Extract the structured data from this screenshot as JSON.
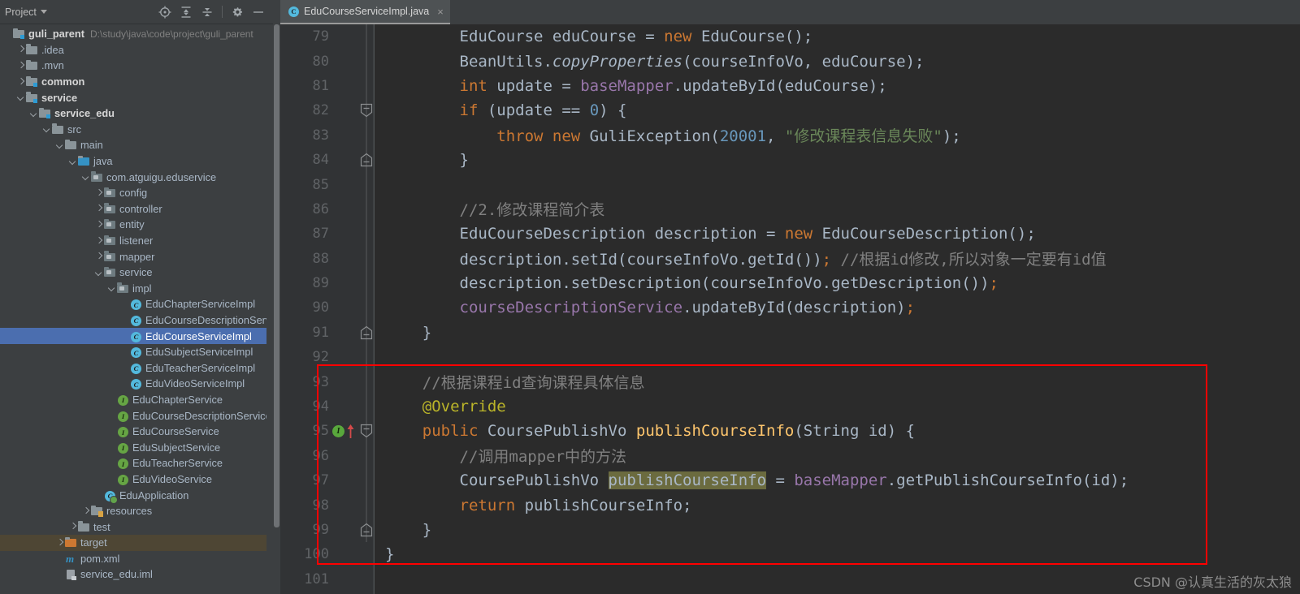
{
  "project_panel": {
    "tab_label": "Project",
    "toolbar_icons": [
      {
        "name": "locate-target-icon",
        "glyph": "target"
      },
      {
        "name": "expand-all-icon",
        "glyph": "expand"
      },
      {
        "name": "collapse-all-icon",
        "glyph": "collapse"
      },
      {
        "name": "settings-gear-icon",
        "glyph": "gear"
      },
      {
        "name": "hide-panel-icon",
        "glyph": "minus"
      }
    ],
    "tree": [
      {
        "label": "guli_parent",
        "path": "D:\\study\\java\\code\\project\\guli_parent",
        "depth": 0,
        "arrow": "none",
        "icon": "module-folder",
        "bold": true,
        "state": "normal"
      },
      {
        "label": ".idea",
        "path": "",
        "depth": 1,
        "arrow": "right",
        "icon": "folder",
        "bold": false,
        "state": "normal"
      },
      {
        "label": ".mvn",
        "path": "",
        "depth": 1,
        "arrow": "right",
        "icon": "folder",
        "bold": false,
        "state": "normal"
      },
      {
        "label": "common",
        "path": "",
        "depth": 1,
        "arrow": "right",
        "icon": "module-folder",
        "bold": true,
        "state": "normal"
      },
      {
        "label": "service",
        "path": "",
        "depth": 1,
        "arrow": "down",
        "icon": "module-folder",
        "bold": true,
        "state": "normal"
      },
      {
        "label": "service_edu",
        "path": "",
        "depth": 2,
        "arrow": "down",
        "icon": "module-folder",
        "bold": true,
        "state": "normal"
      },
      {
        "label": "src",
        "path": "",
        "depth": 3,
        "arrow": "down",
        "icon": "folder",
        "bold": false,
        "state": "normal"
      },
      {
        "label": "main",
        "path": "",
        "depth": 4,
        "arrow": "down",
        "icon": "folder",
        "bold": false,
        "state": "normal"
      },
      {
        "label": "java",
        "path": "",
        "depth": 5,
        "arrow": "down",
        "icon": "source-folder",
        "bold": false,
        "state": "normal"
      },
      {
        "label": "com.atguigu.eduservice",
        "path": "",
        "depth": 6,
        "arrow": "down",
        "icon": "package",
        "bold": false,
        "state": "normal"
      },
      {
        "label": "config",
        "path": "",
        "depth": 7,
        "arrow": "right",
        "icon": "package",
        "bold": false,
        "state": "normal"
      },
      {
        "label": "controller",
        "path": "",
        "depth": 7,
        "arrow": "right",
        "icon": "package",
        "bold": false,
        "state": "normal"
      },
      {
        "label": "entity",
        "path": "",
        "depth": 7,
        "arrow": "right",
        "icon": "package",
        "bold": false,
        "state": "normal"
      },
      {
        "label": "listener",
        "path": "",
        "depth": 7,
        "arrow": "right",
        "icon": "package",
        "bold": false,
        "state": "normal"
      },
      {
        "label": "mapper",
        "path": "",
        "depth": 7,
        "arrow": "right",
        "icon": "package",
        "bold": false,
        "state": "normal"
      },
      {
        "label": "service",
        "path": "",
        "depth": 7,
        "arrow": "down",
        "icon": "package",
        "bold": false,
        "state": "normal"
      },
      {
        "label": "impl",
        "path": "",
        "depth": 8,
        "arrow": "down",
        "icon": "package",
        "bold": false,
        "state": "normal"
      },
      {
        "label": "EduChapterServiceImpl",
        "path": "",
        "depth": 9,
        "arrow": "none",
        "icon": "class",
        "bold": false,
        "state": "normal"
      },
      {
        "label": "EduCourseDescriptionServiceImpl",
        "path": "",
        "depth": 9,
        "arrow": "none",
        "icon": "class",
        "bold": false,
        "state": "normal"
      },
      {
        "label": "EduCourseServiceImpl",
        "path": "",
        "depth": 9,
        "arrow": "none",
        "icon": "class",
        "bold": false,
        "state": "selected"
      },
      {
        "label": "EduSubjectServiceImpl",
        "path": "",
        "depth": 9,
        "arrow": "none",
        "icon": "class",
        "bold": false,
        "state": "normal"
      },
      {
        "label": "EduTeacherServiceImpl",
        "path": "",
        "depth": 9,
        "arrow": "none",
        "icon": "class",
        "bold": false,
        "state": "normal"
      },
      {
        "label": "EduVideoServiceImpl",
        "path": "",
        "depth": 9,
        "arrow": "none",
        "icon": "class",
        "bold": false,
        "state": "normal"
      },
      {
        "label": "EduChapterService",
        "path": "",
        "depth": 8,
        "arrow": "none",
        "icon": "interface",
        "bold": false,
        "state": "normal"
      },
      {
        "label": "EduCourseDescriptionService",
        "path": "",
        "depth": 8,
        "arrow": "none",
        "icon": "interface",
        "bold": false,
        "state": "normal"
      },
      {
        "label": "EduCourseService",
        "path": "",
        "depth": 8,
        "arrow": "none",
        "icon": "interface",
        "bold": false,
        "state": "normal"
      },
      {
        "label": "EduSubjectService",
        "path": "",
        "depth": 8,
        "arrow": "none",
        "icon": "interface",
        "bold": false,
        "state": "normal"
      },
      {
        "label": "EduTeacherService",
        "path": "",
        "depth": 8,
        "arrow": "none",
        "icon": "interface",
        "bold": false,
        "state": "normal"
      },
      {
        "label": "EduVideoService",
        "path": "",
        "depth": 8,
        "arrow": "none",
        "icon": "interface",
        "bold": false,
        "state": "normal"
      },
      {
        "label": "EduApplication",
        "path": "",
        "depth": 7,
        "arrow": "none",
        "icon": "spring-app",
        "bold": false,
        "state": "normal"
      },
      {
        "label": "resources",
        "path": "",
        "depth": 6,
        "arrow": "right",
        "icon": "resource-folder",
        "bold": false,
        "state": "normal"
      },
      {
        "label": "test",
        "path": "",
        "depth": 5,
        "arrow": "right",
        "icon": "folder",
        "bold": false,
        "state": "normal"
      },
      {
        "label": "target",
        "path": "",
        "depth": 4,
        "arrow": "right",
        "icon": "excluded-folder",
        "bold": false,
        "state": "highlighted"
      },
      {
        "label": "pom.xml",
        "path": "",
        "depth": 4,
        "arrow": "none",
        "icon": "maven",
        "bold": false,
        "state": "normal"
      },
      {
        "label": "service_edu.iml",
        "path": "",
        "depth": 4,
        "arrow": "none",
        "icon": "iml",
        "bold": false,
        "state": "normal"
      }
    ]
  },
  "editor": {
    "tab": {
      "label": "EduCourseServiceImpl.java",
      "icon_letter": "C",
      "close_glyph": "×"
    },
    "first_line_number": 79,
    "lines": [
      {
        "n": 79,
        "indent": 2,
        "fold": "stem",
        "html": "EduCourse eduCourse = <span class=\"kw\">new</span> EduCourse();"
      },
      {
        "n": 80,
        "indent": 2,
        "fold": "stem",
        "html": "BeanUtils.<span class=\"ital\">copyProperties</span>(courseInfoVo, eduCourse);"
      },
      {
        "n": 81,
        "indent": 2,
        "fold": "stem",
        "html": "<span class=\"kw\">int</span> update = <span class=\"fld\">baseMapper</span>.updateById(eduCourse);"
      },
      {
        "n": 82,
        "indent": 2,
        "fold": "end-down",
        "html": "<span class=\"kw\">if</span> (update == <span class=\"num\">0</span>) {"
      },
      {
        "n": 83,
        "indent": 3,
        "fold": "stem",
        "html": "<span class=\"kw\">throw new</span> GuliException(<span class=\"num\">20001</span>, <span class=\"str\">\"修改课程表信息失败\"</span>);"
      },
      {
        "n": 84,
        "indent": 2,
        "fold": "end-up",
        "html": "}"
      },
      {
        "n": 85,
        "indent": 2,
        "fold": "stem",
        "html": ""
      },
      {
        "n": 86,
        "indent": 2,
        "fold": "stem",
        "html": "<span class=\"cmt\">//2.修改课程简介表</span>"
      },
      {
        "n": 87,
        "indent": 2,
        "fold": "stem",
        "html": "EduCourseDescription description = <span class=\"kw\">new</span> EduCourseDescription();"
      },
      {
        "n": 88,
        "indent": 2,
        "fold": "stem",
        "html": "description.setId(courseInfoVo.getId())<span class=\"kw\">;</span> <span class=\"cmt\">//根据id修改,所以对象一定要有id值</span>"
      },
      {
        "n": 89,
        "indent": 2,
        "fold": "stem",
        "html": "description.setDescription(courseInfoVo.getDescription())<span class=\"kw\">;</span>"
      },
      {
        "n": 90,
        "indent": 2,
        "fold": "stem",
        "html": "<span class=\"fld\">courseDescriptionService</span>.updateById(description)<span class=\"kw\">;</span>"
      },
      {
        "n": 91,
        "indent": 1,
        "fold": "end-up",
        "html": "}"
      },
      {
        "n": 92,
        "indent": 1,
        "fold": "stem",
        "html": ""
      },
      {
        "n": 93,
        "indent": 1,
        "fold": "stem",
        "html": "<span class=\"cmt\">//根据课程id查询课程具体信息</span>"
      },
      {
        "n": 94,
        "indent": 1,
        "fold": "stem",
        "html": "<span class=\"anno\">@Override</span>"
      },
      {
        "n": 95,
        "indent": 1,
        "fold": "end-down",
        "html": "<span class=\"kw\">public</span> CoursePublishVo <span class=\"mth\">publishCourseInfo</span>(String id) {"
      },
      {
        "n": 96,
        "indent": 2,
        "fold": "stem",
        "html": "<span class=\"cmt\">//调用mapper中的方法</span>"
      },
      {
        "n": 97,
        "indent": 2,
        "fold": "stem",
        "html": "CoursePublishVo <span class=\"hl\">publishCourseInfo</span> = <span class=\"fld\">baseMapper</span>.getPublishCourseInfo(id);"
      },
      {
        "n": 98,
        "indent": 2,
        "fold": "stem",
        "html": "<span class=\"kw\">return</span> publishCourseInfo;"
      },
      {
        "n": 99,
        "indent": 1,
        "fold": "end-up",
        "html": "}"
      },
      {
        "n": 100,
        "indent": 0,
        "fold": "brace",
        "html": "}"
      },
      {
        "n": 101,
        "indent": 0,
        "fold": "none",
        "html": ""
      }
    ],
    "gutter_marker": {
      "line": 95,
      "icon_letter": "I",
      "name": "implementing-method-marker",
      "arrow_color": "#d44a4a",
      "circle_color": "#59a83c"
    },
    "annotation_box": {
      "name": "red-highlight-box",
      "color": "#ff0000",
      "from_line": 93,
      "to_line": 100
    }
  },
  "watermark": {
    "text": "CSDN @认真生活的灰太狼"
  },
  "colors": {
    "panel_bg": "#3c3f41",
    "editor_bg": "#2b2b2b",
    "gutter_bg": "#313335",
    "selection_blue": "#4b6eaf",
    "target_highlight": "#4e4634",
    "identifier_highlight": "#6b6b3f",
    "keyword_orange": "#cc7832",
    "string_green": "#6a8759",
    "number_blue": "#6897bb",
    "comment_gray": "#808080",
    "field_purple": "#9876aa",
    "method_yellow": "#ffc66d",
    "annotation_yellow": "#bbb529",
    "text_default": "#a9b7c6"
  }
}
